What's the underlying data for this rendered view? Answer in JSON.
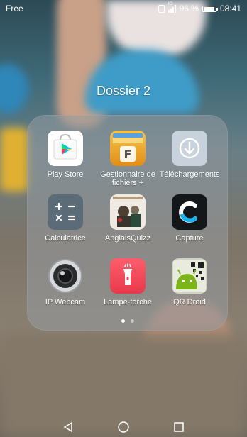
{
  "statusbar": {
    "carrier": "Free",
    "network_tag": "4G",
    "battery_percent": "96 %",
    "battery_level": 0.96,
    "time": "08:41"
  },
  "folder": {
    "title": "Dossier 2",
    "apps": [
      {
        "label": "Play Store",
        "icon": "play-store-icon"
      },
      {
        "label": "Gestionnaire de fichiers +",
        "icon": "file-manager-icon"
      },
      {
        "label": "Téléchargements",
        "icon": "download-icon"
      },
      {
        "label": "Calculatrice",
        "icon": "calculator-icon"
      },
      {
        "label": "AnglaisQuizz",
        "icon": "quiz-icon"
      },
      {
        "label": "Capture",
        "icon": "capture-icon"
      },
      {
        "label": "IP Webcam",
        "icon": "webcam-icon"
      },
      {
        "label": "Lampe-torche",
        "icon": "flashlight-icon"
      },
      {
        "label": "QR Droid",
        "icon": "qr-droid-icon"
      }
    ],
    "page_count": 2,
    "current_page": 1
  },
  "navbar": {
    "buttons": [
      "back",
      "home",
      "recents"
    ]
  },
  "colors": {
    "folder_bg": "#969ba0",
    "torch_red": "#ef4556",
    "play_blue": "#00c3ff",
    "files_orange": "#f0a534"
  }
}
